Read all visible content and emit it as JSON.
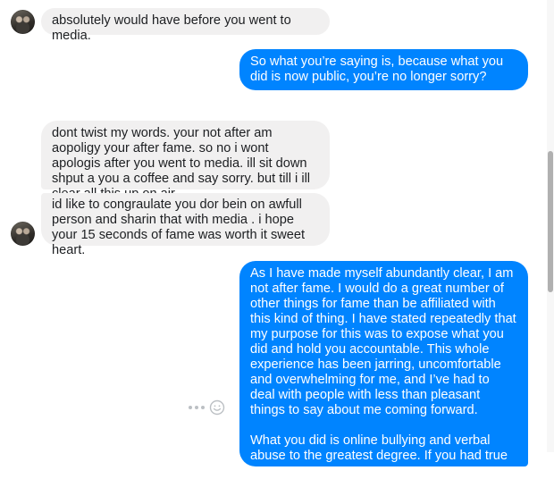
{
  "messages": [
    {
      "id": "m1",
      "direction": "incoming",
      "text": "absolutely would have before you went to media."
    },
    {
      "id": "m2",
      "direction": "outgoing",
      "text": "So what you’re saying is, because what you did is now public, you’re no longer sorry?"
    },
    {
      "id": "m3",
      "direction": "incoming",
      "text": "dont twist my words. your not after am aopoligy your after fame. so no i wont apologis after you went to media. ill sit down shput a you a coffee and say sorry. but till i ill clear all this up on air ."
    },
    {
      "id": "m4",
      "direction": "incoming",
      "text": "id like to congraulate you dor bein on  awfull person and sharin that with media . i hope your 15 seconds of fame was worth it sweet heart."
    },
    {
      "id": "m5",
      "direction": "outgoing",
      "text": "As I have made myself abundantly clear, I am not after fame. I would do a great number of other things for fame than be affiliated with this kind of thing. I have stated repeatedly that my purpose for this was to expose what you did and hold you accountable. This whole experience has been jarring, uncomfortable and overwhelming for me, and I’ve had to deal with people with less than pleasant things to say about me coming forward.\n\nWhat you did is online bullying and verbal abuse to the greatest degree. If you had true remorse"
    }
  ],
  "icons": {
    "avatar": "profile-photo",
    "more": "more-options-icon",
    "reaction": "emoji-reaction-icon"
  },
  "colors": {
    "incoming_bubble": "#f1f0f0",
    "outgoing_bubble": "#0084ff"
  }
}
